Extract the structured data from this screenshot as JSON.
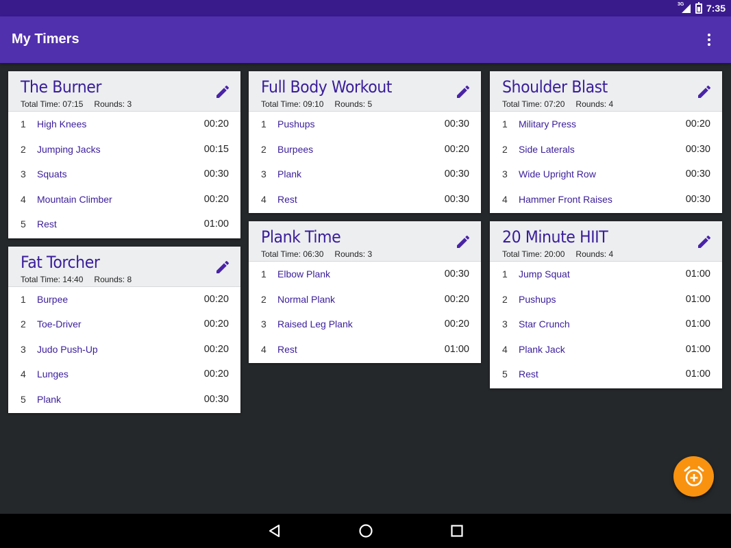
{
  "status_bar": {
    "network": "3G",
    "time": "7:35"
  },
  "app_bar": {
    "title": "My Timers"
  },
  "total_time_label": "Total Time:",
  "rounds_label": "Rounds:",
  "columns": [
    [
      {
        "title": "The Burner",
        "total_time": "07:15",
        "rounds": "3",
        "items": [
          {
            "num": "1",
            "name": "High Knees",
            "time": "00:20"
          },
          {
            "num": "2",
            "name": "Jumping Jacks",
            "time": "00:15"
          },
          {
            "num": "3",
            "name": "Squats",
            "time": "00:30"
          },
          {
            "num": "4",
            "name": "Mountain Climber",
            "time": "00:20"
          },
          {
            "num": "5",
            "name": "Rest",
            "time": "01:00"
          }
        ]
      },
      {
        "title": "Fat Torcher",
        "total_time": "14:40",
        "rounds": "8",
        "items": [
          {
            "num": "1",
            "name": "Burpee",
            "time": "00:20"
          },
          {
            "num": "2",
            "name": "Toe-Driver",
            "time": "00:20"
          },
          {
            "num": "3",
            "name": "Judo Push-Up",
            "time": "00:20"
          },
          {
            "num": "4",
            "name": "Lunges",
            "time": "00:20"
          },
          {
            "num": "5",
            "name": "Plank",
            "time": "00:30"
          }
        ]
      }
    ],
    [
      {
        "title": "Full Body Workout",
        "total_time": "09:10",
        "rounds": "5",
        "items": [
          {
            "num": "1",
            "name": "Pushups",
            "time": "00:30"
          },
          {
            "num": "2",
            "name": "Burpees",
            "time": "00:20"
          },
          {
            "num": "3",
            "name": "Plank",
            "time": "00:30"
          },
          {
            "num": "4",
            "name": "Rest",
            "time": "00:30"
          }
        ]
      },
      {
        "title": "Plank Time",
        "total_time": "06:30",
        "rounds": "3",
        "items": [
          {
            "num": "1",
            "name": "Elbow Plank",
            "time": "00:30"
          },
          {
            "num": "2",
            "name": "Normal Plank",
            "time": "00:20"
          },
          {
            "num": "3",
            "name": "Raised Leg Plank",
            "time": "00:20"
          },
          {
            "num": "4",
            "name": "Rest",
            "time": "01:00"
          }
        ]
      }
    ],
    [
      {
        "title": "Shoulder Blast",
        "total_time": "07:20",
        "rounds": "4",
        "items": [
          {
            "num": "1",
            "name": "Military Press",
            "time": "00:20"
          },
          {
            "num": "2",
            "name": "Side Laterals",
            "time": "00:30"
          },
          {
            "num": "3",
            "name": "Wide Upright Row",
            "time": "00:30"
          },
          {
            "num": "4",
            "name": "Hammer Front Raises",
            "time": "00:30"
          }
        ]
      },
      {
        "title": "20 Minute HIIT",
        "total_time": "20:00",
        "rounds": "4",
        "items": [
          {
            "num": "1",
            "name": "Jump Squat",
            "time": "01:00"
          },
          {
            "num": "2",
            "name": "Pushups",
            "time": "01:00"
          },
          {
            "num": "3",
            "name": "Star Crunch",
            "time": "01:00"
          },
          {
            "num": "4",
            "name": "Plank Jack",
            "time": "01:00"
          },
          {
            "num": "5",
            "name": "Rest",
            "time": "01:00"
          }
        ]
      }
    ]
  ],
  "icons": {
    "edit": "pencil-icon",
    "fab": "add-alarm-icon",
    "overflow": "more-vert-icon",
    "nav_back": "back-triangle-icon",
    "nav_home": "home-circle-icon",
    "nav_recents": "recents-square-icon"
  },
  "colors": {
    "status_bar": "#3a1b8c",
    "app_bar": "#5130ad",
    "accent_text": "#3a1d9a",
    "fab": "#f9920f",
    "background": "#25282b"
  }
}
